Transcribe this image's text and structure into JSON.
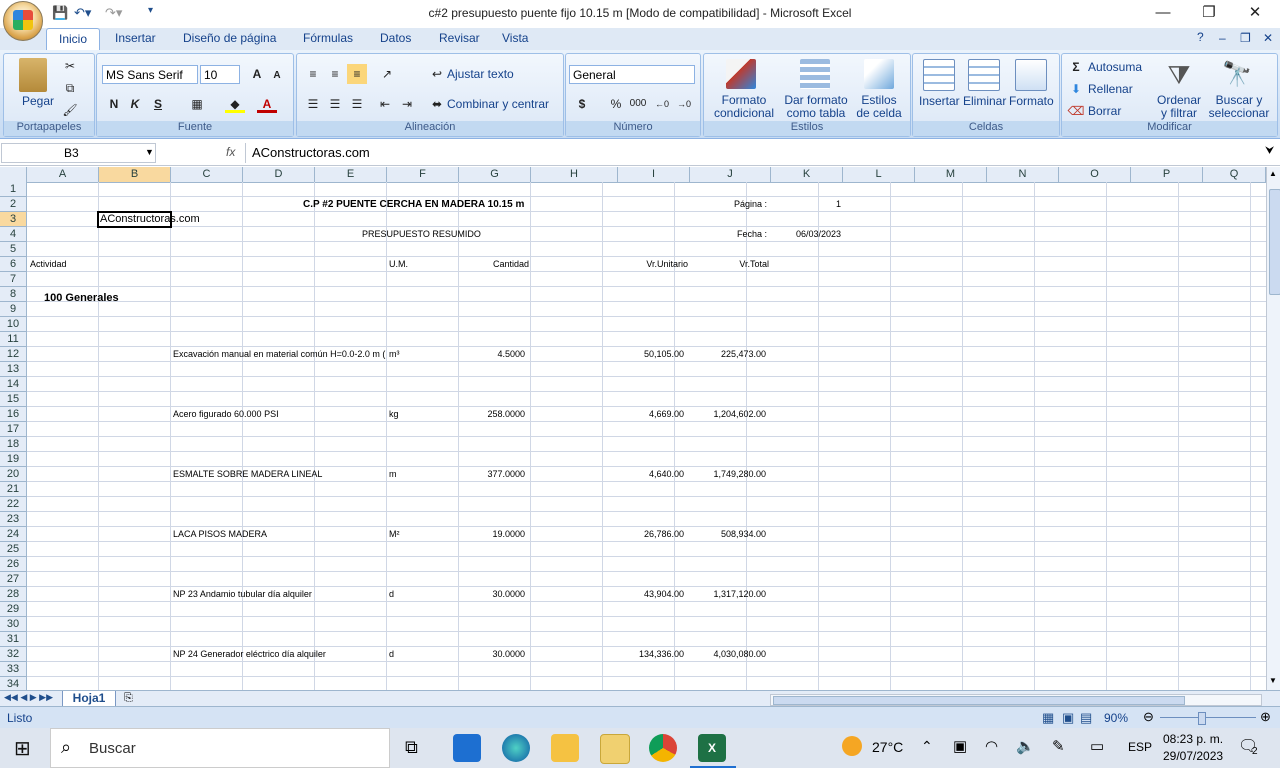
{
  "window": {
    "title": "c#2 presupuesto puente fijo 10.15 m  [Modo de compatibilidad] - Microsoft Excel",
    "minimize": "—",
    "restore": "❐",
    "close": "✕"
  },
  "ribbon": {
    "tabs": [
      "Inicio",
      "Insertar",
      "Diseño de página",
      "Fórmulas",
      "Datos",
      "Revisar",
      "Vista"
    ],
    "clipboard": {
      "paste": "Pegar",
      "label": "Portapapeles"
    },
    "font": {
      "name": "MS Sans Serif",
      "size": "10",
      "bold": "N",
      "italic": "K",
      "underline": "S",
      "label": "Fuente"
    },
    "alignment": {
      "wrap": "Ajustar texto",
      "merge": "Combinar y centrar",
      "label": "Alineación"
    },
    "number": {
      "format": "General",
      "currency": "$",
      "percent": "%",
      "thousands": "000",
      "label": "Número"
    },
    "styles": {
      "conditional": "Formato condicional",
      "table": "Dar formato como tabla",
      "cell": "Estilos de celda",
      "label": "Estilos"
    },
    "cells": {
      "insert": "Insertar",
      "delete": "Eliminar",
      "format": "Formato",
      "label": "Celdas"
    },
    "editing": {
      "autosum": "Autosuma",
      "fill": "Rellenar",
      "clear": "Borrar",
      "sort": "Ordenar y filtrar",
      "find": "Buscar y seleccionar",
      "label": "Modificar"
    }
  },
  "formula_bar": {
    "namebox": "B3",
    "fx": "fx",
    "content": "AConstructoras.com"
  },
  "columns": [
    "A",
    "B",
    "C",
    "D",
    "E",
    "F",
    "G",
    "H",
    "I",
    "J",
    "K",
    "L",
    "M",
    "N",
    "O",
    "P",
    "Q"
  ],
  "rows": [
    "1",
    "2",
    "3",
    "4",
    "5",
    "6",
    "7",
    "8",
    "9",
    "10",
    "11",
    "12",
    "13",
    "14",
    "15",
    "16",
    "17",
    "18",
    "19",
    "20",
    "21",
    "22",
    "23",
    "24",
    "25",
    "26",
    "27",
    "28",
    "29",
    "30",
    "31",
    "32",
    "33",
    "34"
  ],
  "sheet": {
    "title": "C.P #2 PUENTE CERCHA EN MADERA  10.15 m",
    "page_label": "Página :",
    "page_value": "1",
    "website": "AConstructoras.com",
    "subtitle": "PRESUPUESTO RESUMIDO",
    "date_label": "Fecha :",
    "date_value": "06/03/2023",
    "headers": {
      "activity": "Actividad",
      "um": "U.M.",
      "qty": "Cantidad",
      "unit": "Vr.Unitario",
      "total": "Vr.Total"
    },
    "section": "100  Generales",
    "items": [
      {
        "desc": "Excavación manual en material común H=0.0-2.0 m (",
        "um": "m³",
        "qty": "4.5000",
        "unit": "50,105.00",
        "total": "225,473.00"
      },
      {
        "desc": "Acero figurado 60.000 PSI",
        "um": "kg",
        "qty": "258.0000",
        "unit": "4,669.00",
        "total": "1,204,602.00"
      },
      {
        "desc": "ESMALTE SOBRE MADERA LINEAL",
        "um": "m",
        "qty": "377.0000",
        "unit": "4,640.00",
        "total": "1,749,280.00"
      },
      {
        "desc": "LACA PISOS MADERA",
        "um": "M²",
        "qty": "19.0000",
        "unit": "26,786.00",
        "total": "508,934.00"
      },
      {
        "desc": "NP 23 Andamio tubular día alquiler",
        "um": "d",
        "qty": "30.0000",
        "unit": "43,904.00",
        "total": "1,317,120.00"
      },
      {
        "desc": "NP 24 Generador eléctrico día alquiler",
        "um": "d",
        "qty": "30.0000",
        "unit": "134,336.00",
        "total": "4,030,080.00"
      }
    ]
  },
  "sheet_tab": "Hoja1",
  "status": {
    "ready": "Listo",
    "zoom": "90%"
  },
  "taskbar": {
    "search": "Buscar",
    "temp": "27°C",
    "lang": "ESP",
    "time": "08:23 p. m.",
    "date": "29/07/2023",
    "notif": "2"
  }
}
